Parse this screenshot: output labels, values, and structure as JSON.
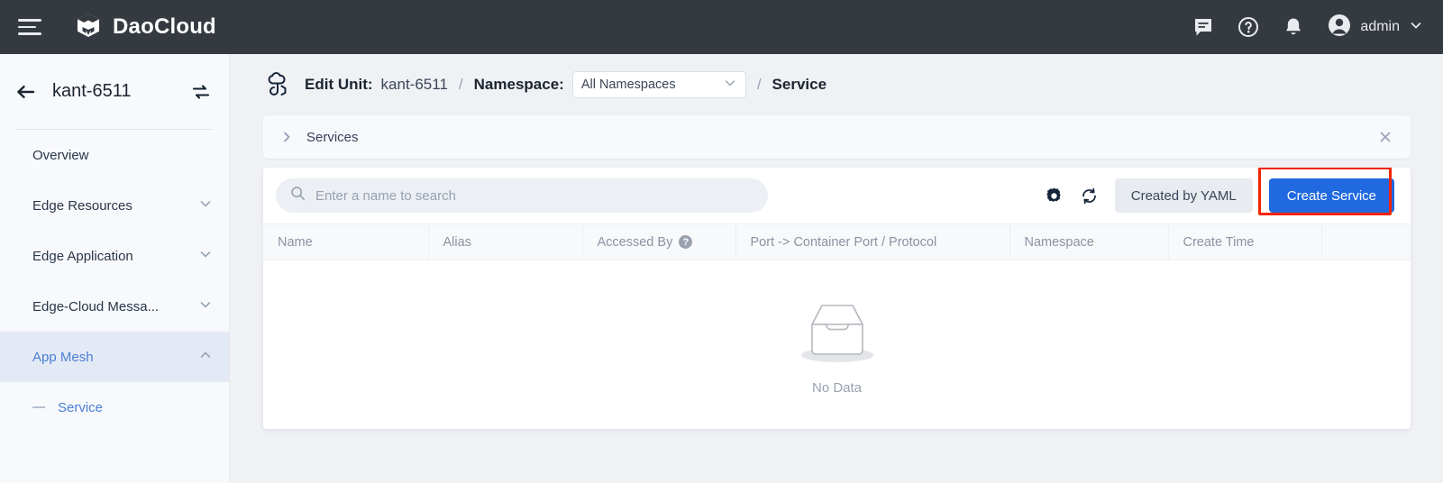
{
  "topbar": {
    "menu_icon": "hamburger-icon",
    "brand": "DaoCloud",
    "icons": [
      "chat-icon",
      "help-icon",
      "bell-icon"
    ],
    "user": "admin",
    "user_chevron": "chevron-down-icon"
  },
  "sidebar": {
    "back_icon": "back-arrow-icon",
    "unit": "kant-6511",
    "switch_icon": "switch-unit-icon",
    "items": [
      {
        "label": "Overview",
        "expandable": false,
        "active": false
      },
      {
        "label": "Edge Resources",
        "expandable": true,
        "active": false,
        "chevron": "chevron-down-icon"
      },
      {
        "label": "Edge Application",
        "expandable": true,
        "active": false,
        "chevron": "chevron-down-icon"
      },
      {
        "label": "Edge-Cloud Messa...",
        "expandable": true,
        "active": false,
        "chevron": "chevron-down-icon"
      },
      {
        "label": "App Mesh",
        "expandable": true,
        "active": true,
        "chevron": "chevron-up-icon"
      }
    ],
    "subitem": {
      "label": "Service",
      "active": true
    }
  },
  "breadcrumb": {
    "icon": "cloud-unit-icon",
    "edit_unit_label": "Edit Unit:",
    "unit_value": "kant-6511",
    "sep": "/",
    "namespace_label": "Namespace:",
    "namespace_value": "All Namespaces",
    "namespace_chevron": "chevron-down-icon",
    "sep2": "/",
    "current": "Service"
  },
  "panel": {
    "chevron": "chevron-right-icon",
    "title": "Services",
    "close": "close-icon"
  },
  "toolbar": {
    "search_placeholder": "Enter a name to search",
    "search_value": "",
    "search_icon": "search-icon",
    "settings_icon": "gear-icon",
    "refresh_icon": "refresh-icon",
    "yaml_label": "Created by YAML",
    "create_label": "Create Service",
    "create_color": "#2069e0",
    "highlight_color": "#f42400"
  },
  "table": {
    "columns": [
      {
        "label": "Name",
        "help": false
      },
      {
        "label": "Alias",
        "help": false
      },
      {
        "label": "Accessed By",
        "help": true
      },
      {
        "label": "Port -> Container Port / Protocol",
        "help": false
      },
      {
        "label": "Namespace",
        "help": false
      },
      {
        "label": "Create Time",
        "help": false
      },
      {
        "label": "",
        "help": false
      }
    ],
    "rows": [],
    "empty_text": "No Data",
    "empty_icon": "empty-inbox-icon"
  }
}
